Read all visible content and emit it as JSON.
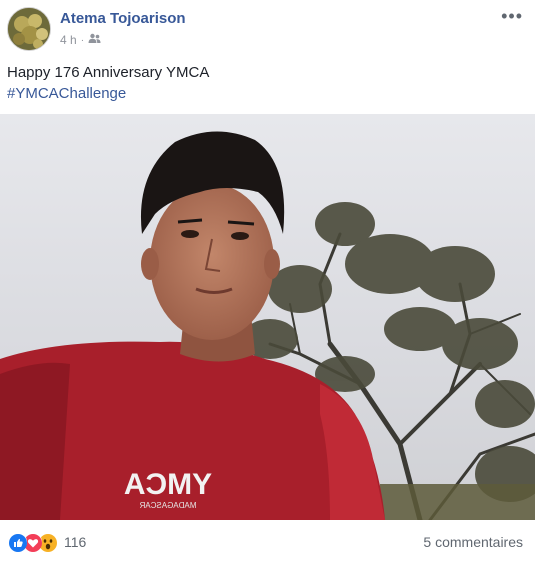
{
  "post": {
    "author": "Atema Tojoarison",
    "time": "4 h",
    "separator": "·",
    "audience_icon": "friends-icon",
    "more_icon": "more-icon",
    "text_line1": "Happy 176 Anniversary YMCA",
    "hashtag": "#YMCAChallenge"
  },
  "photo": {
    "shirt_text": "YMCA",
    "shirt_subtext": "MADAGASCAR"
  },
  "footer": {
    "reaction_icons": [
      "like-icon",
      "love-icon",
      "wow-icon"
    ],
    "reaction_count": "116",
    "comments": "5 commentaires"
  },
  "colors": {
    "link": "#385898",
    "muted": "#90949c",
    "like": "#1877f2",
    "love": "#f33e58",
    "wow": "#f7b125"
  }
}
